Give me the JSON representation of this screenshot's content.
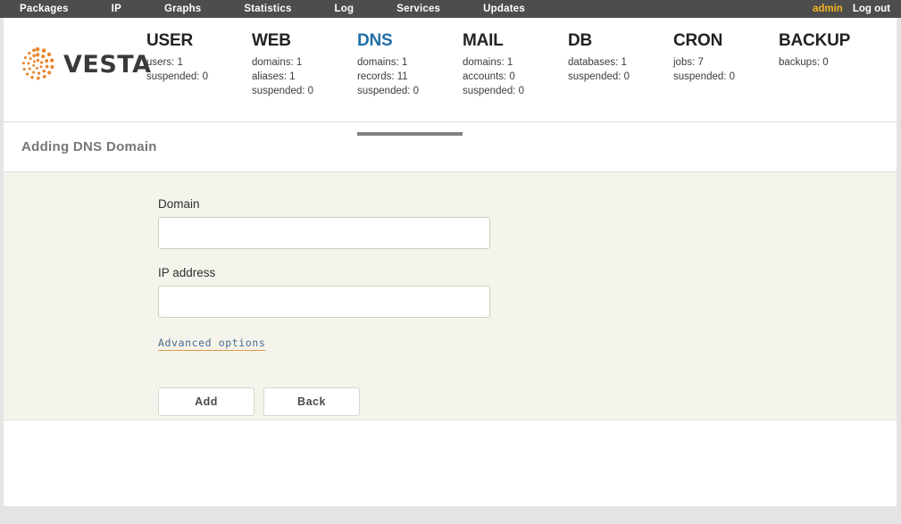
{
  "topbar": {
    "menu": [
      {
        "label": "Packages",
        "name": "nav-packages"
      },
      {
        "label": "IP",
        "name": "nav-ip"
      },
      {
        "label": "Graphs",
        "name": "nav-graphs"
      },
      {
        "label": "Statistics",
        "name": "nav-statistics"
      },
      {
        "label": "Log",
        "name": "nav-log"
      },
      {
        "label": "Services",
        "name": "nav-services"
      },
      {
        "label": "Updates",
        "name": "nav-updates"
      }
    ],
    "user": "admin",
    "logout": "Log out"
  },
  "brand": {
    "name": "VESTA",
    "logo_icon": "vesta-dots-spiral-icon",
    "logo_color": "#e8842a"
  },
  "stats": [
    {
      "title": "USER",
      "active": false,
      "lines": [
        "users: 1",
        "suspended: 0"
      ]
    },
    {
      "title": "WEB",
      "active": false,
      "lines": [
        "domains: 1",
        "aliases: 1",
        "suspended: 0"
      ]
    },
    {
      "title": "DNS",
      "active": true,
      "lines": [
        "domains: 1",
        "records: 11",
        "suspended: 0"
      ]
    },
    {
      "title": "MAIL",
      "active": false,
      "lines": [
        "domains: 1",
        "accounts: 0",
        "suspended: 0"
      ]
    },
    {
      "title": "DB",
      "active": false,
      "lines": [
        "databases: 1",
        "suspended: 0"
      ]
    },
    {
      "title": "CRON",
      "active": false,
      "lines": [
        "jobs: 7",
        "suspended: 0"
      ]
    },
    {
      "title": "BACKUP",
      "active": false,
      "lines": [
        "backups: 0"
      ]
    }
  ],
  "page": {
    "title": "Adding DNS Domain"
  },
  "form": {
    "domain": {
      "label": "Domain",
      "value": "",
      "placeholder": ""
    },
    "ip_address": {
      "label": "IP address",
      "value": "",
      "placeholder": ""
    },
    "advanced_options_link": "Advanced options",
    "submit_label": "Add",
    "back_label": "Back"
  },
  "colors": {
    "topbar_bg": "#4d4d4d",
    "accent_orange": "#e8842a",
    "active_tab_blue": "#1f6fa8",
    "form_bg": "#f5f4ec",
    "user_gold": "#f0b323",
    "link_underline": "#e09a3e"
  }
}
